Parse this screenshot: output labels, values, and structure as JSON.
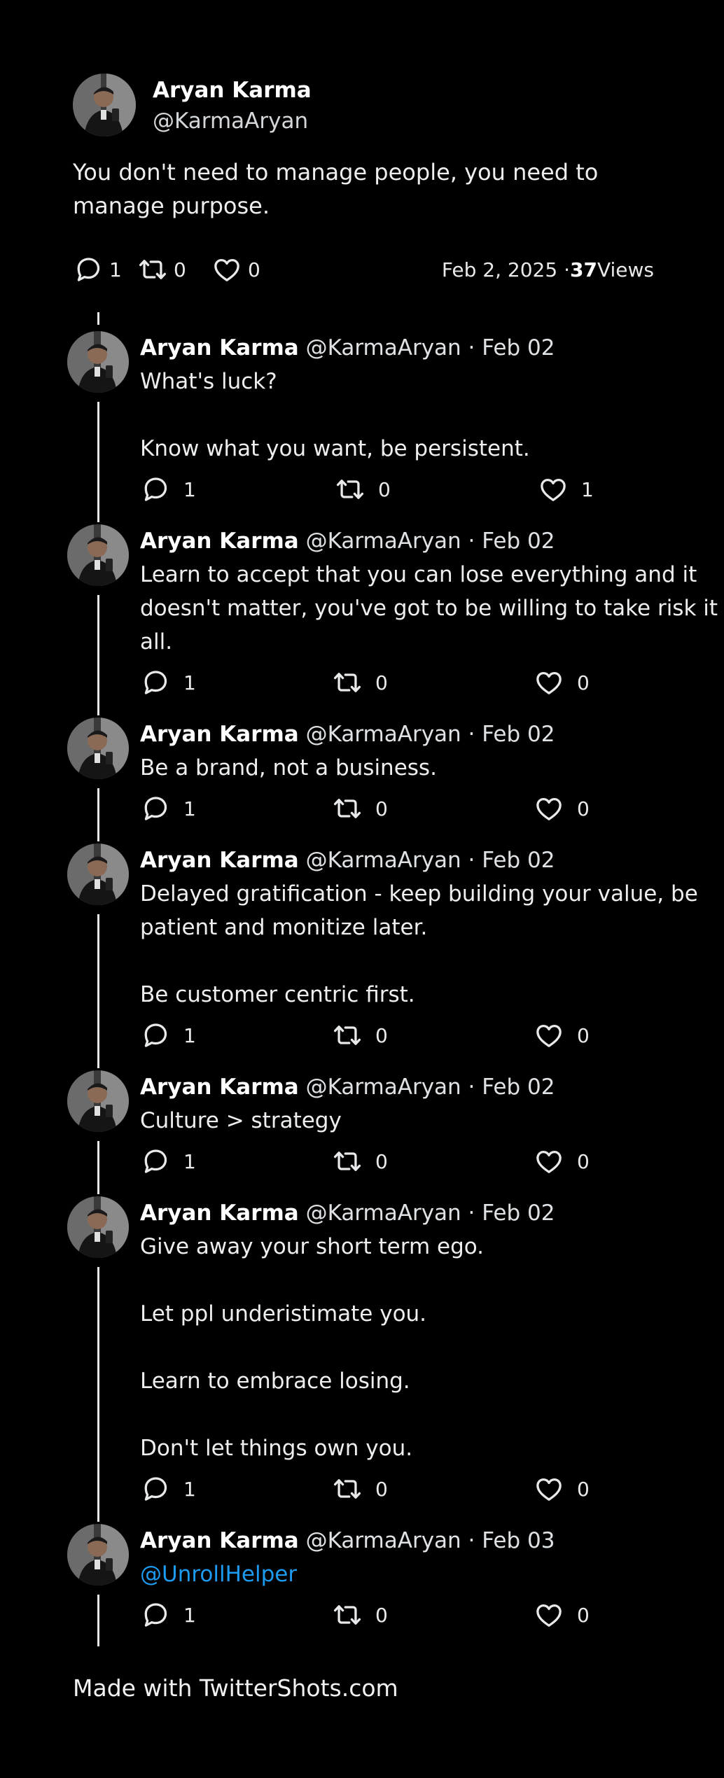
{
  "main_tweet": {
    "author_name": "Aryan Karma",
    "author_handle": "@KarmaAryan",
    "text": "You don't need to manage people, you need to manage purpose.",
    "replies": "1",
    "retweets": "0",
    "likes": "0",
    "date": "Feb 2, 2025 · ",
    "views_count": "37",
    "views_label": " Views"
  },
  "replies": [
    {
      "name": "Aryan Karma",
      "handle_date": " @KarmaAryan · Feb 02",
      "lines": [
        "What's luck?",
        "",
        "Know what you want, be persistent."
      ],
      "replies": "1",
      "retweets": "0",
      "likes": "1"
    },
    {
      "name": "Aryan Karma",
      "handle_date": " @KarmaAryan · Feb 02",
      "lines": [
        "Learn to accept that you can lose everything and it doesn't matter, you've got to be willing to take risk it all."
      ],
      "replies": "1",
      "retweets": "0",
      "likes": "0"
    },
    {
      "name": "Aryan Karma",
      "handle_date": " @KarmaAryan · Feb 02",
      "lines": [
        "Be a brand, not a business."
      ],
      "replies": "1",
      "retweets": "0",
      "likes": "0"
    },
    {
      "name": "Aryan Karma",
      "handle_date": " @KarmaAryan · Feb 02",
      "lines": [
        "Delayed gratification - keep building your value, be patient and monitize later.",
        "",
        "Be customer centric first."
      ],
      "replies": "1",
      "retweets": "0",
      "likes": "0"
    },
    {
      "name": "Aryan Karma",
      "handle_date": " @KarmaAryan · Feb 02",
      "lines": [
        "Culture > strategy"
      ],
      "replies": "1",
      "retweets": "0",
      "likes": "0"
    },
    {
      "name": "Aryan Karma",
      "handle_date": " @KarmaAryan · Feb 02",
      "lines": [
        "Give away your short term ego.",
        "",
        "Let ppl underistimate you.",
        "",
        "Learn to embrace losing.",
        "",
        "Don't let things own you."
      ],
      "replies": "1",
      "retweets": "0",
      "likes": "0"
    },
    {
      "name": "Aryan Karma",
      "handle_date": " @KarmaAryan · Feb 03",
      "mention": "@UnrollHelper",
      "lines": [],
      "replies": "1",
      "retweets": "0",
      "likes": "0"
    }
  ],
  "footer": "Made with TwitterShots.com",
  "icons": {
    "reply": "speech-bubble-icon",
    "retweet": "retweet-icon",
    "like": "heart-icon",
    "avatar": "avatar"
  },
  "colors": {
    "background": "#000000",
    "text": "#e7e9ea",
    "mention": "#1d9bf0",
    "thread_line": "#e8e8e8"
  }
}
